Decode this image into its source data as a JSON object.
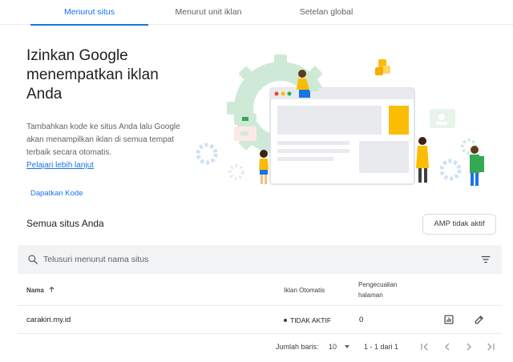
{
  "tabs": [
    {
      "label": "Menurut situs",
      "active": true
    },
    {
      "label": "Menurut unit iklan",
      "active": false
    },
    {
      "label": "Setelan global",
      "active": false
    }
  ],
  "hero": {
    "title": "Izinkan Google menempatkan iklan Anda",
    "description": "Tambahkan kode ke situs Anda lalu Google akan menampilkan iklan di semua tempat terbaik secara otomatis.",
    "learn_more": "Pelajari lebih lanjut",
    "get_code": "Dapatkan Kode"
  },
  "section": {
    "title": "Semua situs Anda",
    "amp_button": "AMP tidak aktif"
  },
  "search": {
    "placeholder": "Telusuri menurut nama situs",
    "value": ""
  },
  "table": {
    "columns": {
      "name": "Nama",
      "auto_ads": "Iklan Otomatis",
      "exclusions": "Pengecualian halaman"
    },
    "rows": [
      {
        "site": "carakiri.my.id",
        "status": "TIDAK AKTIF",
        "exclusions": "0"
      }
    ]
  },
  "pagination": {
    "rows_label": "Jumlah baris:",
    "rows_value": "10",
    "range": "1 - 1 dari 1"
  },
  "colors": {
    "accent": "#1a73e8",
    "illustration_green": "#ceead6",
    "illustration_yellow": "#fbbc04"
  }
}
